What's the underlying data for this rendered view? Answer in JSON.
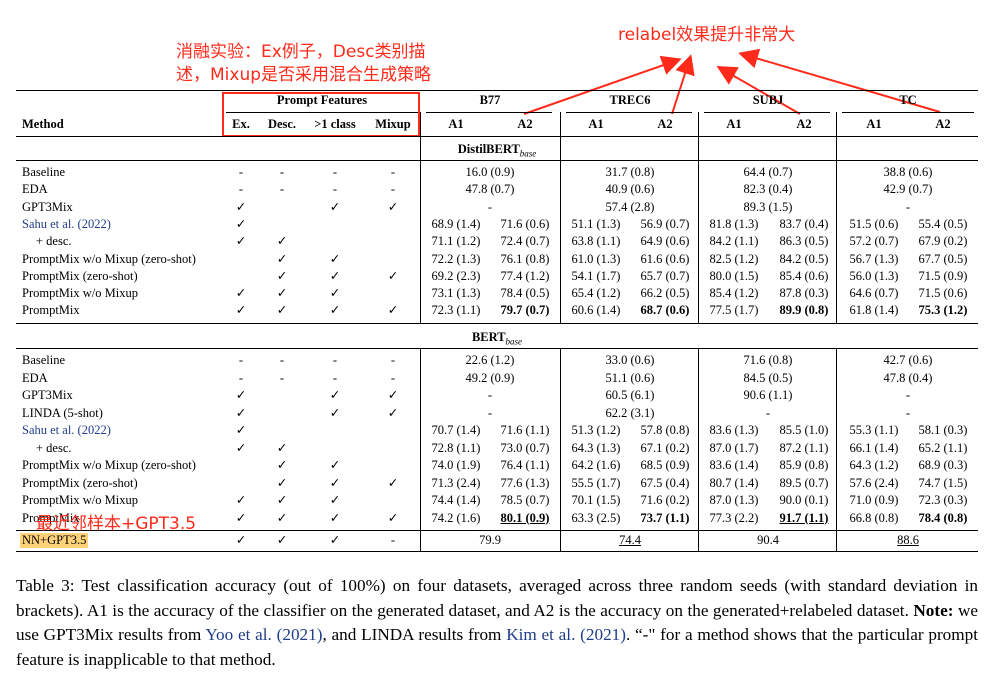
{
  "annotations": {
    "ablation_line1": "消融实验：Ex例子，Desc类别描",
    "ablation_line2": "述，Mixup是否采用混合生成策略",
    "relabel_note": "relabel效果提升非常大",
    "nn_note": "最近邻样本+GPT3.5",
    "color": "#ff2a1a"
  },
  "table": {
    "header": {
      "prompt_features": "Prompt Features",
      "method": "Method",
      "features": [
        "Ex.",
        "Desc.",
        ">1 class",
        "Mixup"
      ],
      "datasets": [
        "B77",
        "TREC6",
        "SUBJ",
        "TC"
      ],
      "metrics": [
        "A1",
        "A2",
        "A1",
        "A2",
        "A1",
        "A2",
        "A1",
        "A2"
      ]
    },
    "section1": {
      "title": "DistilBERT",
      "sub": "base",
      "rows": [
        {
          "method": "Baseline",
          "f": [
            "-",
            "-",
            "-",
            "-"
          ],
          "v": [
            "16.0 (0.9)",
            "",
            "31.7 (0.8)",
            "",
            "64.4 (0.7)",
            "",
            "38.8 (0.6)",
            ""
          ]
        },
        {
          "method": "EDA",
          "f": [
            "-",
            "-",
            "-",
            "-"
          ],
          "v": [
            "47.8 (0.7)",
            "",
            "40.9 (0.6)",
            "",
            "82.3 (0.4)",
            "",
            "42.9 (0.7)",
            ""
          ]
        },
        {
          "method": "GPT3Mix",
          "f": [
            "✓",
            "",
            "✓",
            "✓"
          ],
          "v": [
            "-",
            "",
            "57.4 (2.8)",
            "",
            "89.3 (1.5)",
            "",
            "-",
            ""
          ]
        },
        {
          "method": "Sahu et al. (2022)",
          "f": [
            "✓",
            "",
            "",
            ""
          ],
          "v": [
            "68.9 (1.4)",
            "71.6 (0.6)",
            "51.1 (1.3)",
            "56.9 (0.7)",
            "81.8 (1.3)",
            "83.7 (0.4)",
            "51.5 (0.6)",
            "55.4 (0.5)"
          ]
        },
        {
          "method": "+ desc.",
          "f": [
            "✓",
            "✓",
            "",
            ""
          ],
          "v": [
            "71.1 (1.2)",
            "72.4 (0.7)",
            "63.8 (1.1)",
            "64.9 (0.6)",
            "84.2 (1.1)",
            "86.3 (0.5)",
            "57.2 (0.7)",
            "67.9 (0.2)"
          ]
        },
        {
          "method": "PromptMix w/o Mixup (zero-shot)",
          "f": [
            "",
            "✓",
            "✓",
            ""
          ],
          "v": [
            "72.2 (1.3)",
            "76.1 (0.8)",
            "61.0 (1.3)",
            "61.6 (0.6)",
            "82.5 (1.2)",
            "84.2 (0.5)",
            "56.7 (1.3)",
            "67.7 (0.5)"
          ]
        },
        {
          "method": "PromptMix (zero-shot)",
          "f": [
            "",
            "✓",
            "✓",
            "✓"
          ],
          "v": [
            "69.2 (2.3)",
            "77.4 (1.2)",
            "54.1 (1.7)",
            "65.7 (0.7)",
            "80.0 (1.5)",
            "85.4 (0.6)",
            "56.0 (1.3)",
            "71.5 (0.9)"
          ]
        },
        {
          "method": "PromptMix w/o Mixup",
          "f": [
            "✓",
            "✓",
            "✓",
            ""
          ],
          "v": [
            "73.1 (1.3)",
            "78.4 (0.5)",
            "65.4 (1.2)",
            "66.2 (0.5)",
            "85.4 (1.2)",
            "87.8 (0.3)",
            "64.6 (0.7)",
            "71.5 (0.6)"
          ]
        },
        {
          "method": "PromptMix",
          "f": [
            "✓",
            "✓",
            "✓",
            "✓"
          ],
          "v": [
            "72.3 (1.1)",
            "79.7 (0.7)",
            "60.6 (1.4)",
            "68.7 (0.6)",
            "77.5 (1.7)",
            "89.9 (0.8)",
            "61.8 (1.4)",
            "75.3 (1.2)"
          ]
        }
      ]
    },
    "section2": {
      "title": "BERT",
      "sub": "base",
      "rows": [
        {
          "method": "Baseline",
          "f": [
            "-",
            "-",
            "-",
            "-"
          ],
          "v": [
            "22.6 (1.2)",
            "",
            "33.0 (0.6)",
            "",
            "71.6 (0.8)",
            "",
            "42.7 (0.6)",
            ""
          ]
        },
        {
          "method": "EDA",
          "f": [
            "-",
            "-",
            "-",
            "-"
          ],
          "v": [
            "49.2 (0.9)",
            "",
            "51.1 (0.6)",
            "",
            "84.5 (0.5)",
            "",
            "47.8 (0.4)",
            ""
          ]
        },
        {
          "method": "GPT3Mix",
          "f": [
            "✓",
            "",
            "✓",
            "✓"
          ],
          "v": [
            "-",
            "",
            "60.5 (6.1)",
            "",
            "90.6 (1.1)",
            "",
            "-",
            ""
          ]
        },
        {
          "method": "LINDA (5-shot)",
          "f": [
            "✓",
            "",
            "✓",
            "✓"
          ],
          "v": [
            "-",
            "",
            "62.2 (3.1)",
            "",
            "-",
            "",
            "-",
            ""
          ]
        },
        {
          "method": "Sahu et al. (2022)",
          "f": [
            "✓",
            "",
            "",
            ""
          ],
          "v": [
            "70.7 (1.4)",
            "71.6 (1.1)",
            "51.3 (1.2)",
            "57.8 (0.8)",
            "83.6 (1.3)",
            "85.5 (1.0)",
            "55.3 (1.1)",
            "58.1 (0.3)"
          ]
        },
        {
          "method": "+ desc.",
          "f": [
            "✓",
            "✓",
            "",
            ""
          ],
          "v": [
            "72.8 (1.1)",
            "73.0 (0.7)",
            "64.3 (1.3)",
            "67.1 (0.2)",
            "87.0 (1.7)",
            "87.2 (1.1)",
            "66.1 (1.4)",
            "65.2 (1.1)"
          ]
        },
        {
          "method": "PromptMix w/o Mixup (zero-shot)",
          "f": [
            "",
            "✓",
            "✓",
            ""
          ],
          "v": [
            "74.0 (1.9)",
            "76.4 (1.1)",
            "64.2 (1.6)",
            "68.5 (0.9)",
            "83.6 (1.4)",
            "85.9 (0.8)",
            "64.3 (1.2)",
            "68.9 (0.3)"
          ]
        },
        {
          "method": "PromptMix (zero-shot)",
          "f": [
            "",
            "✓",
            "✓",
            "✓"
          ],
          "v": [
            "71.3 (2.4)",
            "77.6 (1.3)",
            "55.5 (1.7)",
            "67.5 (0.4)",
            "80.7 (1.4)",
            "89.5 (0.7)",
            "57.6 (2.4)",
            "74.7 (1.5)"
          ]
        },
        {
          "method": "PromptMix w/o Mixup",
          "f": [
            "✓",
            "✓",
            "✓",
            ""
          ],
          "v": [
            "74.4 (1.4)",
            "78.5 (0.7)",
            "70.1 (1.5)",
            "71.6 (0.2)",
            "87.0 (1.3)",
            "90.0 (0.1)",
            "71.0 (0.9)",
            "72.3 (0.3)"
          ]
        },
        {
          "method": "PromptMix",
          "f": [
            "✓",
            "✓",
            "✓",
            "✓"
          ],
          "v": [
            "74.2 (1.6)",
            "80.1 (0.9)",
            "63.3 (2.5)",
            "73.7 (1.1)",
            "77.3 (2.2)",
            "91.7 (1.1)",
            "66.8 (0.8)",
            "78.4 (0.8)"
          ]
        }
      ]
    },
    "nn_row": {
      "method": "NN+GPT3.5",
      "f": [
        "✓",
        "✓",
        "✓",
        "-"
      ],
      "v": [
        "79.9",
        "74.4",
        "90.4",
        "88.6"
      ]
    }
  },
  "caption": {
    "label": "Table 3:",
    "text1": " Test classification accuracy (out of 100%) on four datasets, averaged across three random seeds (with standard deviation in brackets). A1 is the accuracy of the classifier on the generated dataset, and A2 is the accuracy on the generated+relabeled dataset. ",
    "note_label": "Note:",
    "text2": " we use GPT3Mix results from ",
    "cite1": "Yoo et al.",
    "cite1_year": "(2021)",
    "text3": ", and LINDA results from ",
    "cite2": "Kim et al.",
    "cite2_year": "(2021)",
    "text4": ". “-\" for a method shows that the particular prompt feature is inapplicable to that method."
  }
}
